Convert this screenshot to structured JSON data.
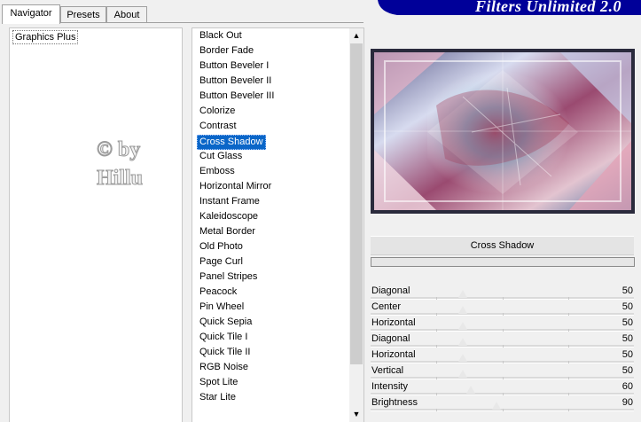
{
  "tabs": [
    {
      "label": "Navigator",
      "active": true
    },
    {
      "label": "Presets",
      "active": false
    },
    {
      "label": "About",
      "active": false
    }
  ],
  "banner": {
    "title": "Filters Unlimited 2.0"
  },
  "category": {
    "selected": "Graphics Plus"
  },
  "watermark": {
    "text": "© by Hillu"
  },
  "filters": {
    "items": [
      "Black Out",
      "Border Fade",
      "Button Beveler I",
      "Button Beveler II",
      "Button Beveler III",
      "Colorize",
      "Contrast",
      "Cross Shadow",
      "Cut Glass",
      "Emboss",
      "Horizontal Mirror",
      "Instant Frame",
      "Kaleidoscope",
      "Metal Border",
      "Old Photo",
      "Page Curl",
      "Panel Stripes",
      "Peacock",
      "Pin Wheel",
      "Quick Sepia",
      "Quick Tile I",
      "Quick Tile II",
      "RGB Noise",
      "Spot Lite",
      "Star Lite"
    ],
    "selected_index": 7
  },
  "scrollbar": {
    "up_icon": "▲",
    "down_icon": "▼"
  },
  "current_filter": {
    "name": "Cross Shadow"
  },
  "parameters": [
    {
      "label": "Diagonal",
      "value": 50
    },
    {
      "label": "Center",
      "value": 50
    },
    {
      "label": "Horizontal",
      "value": 50
    },
    {
      "label": "Diagonal",
      "value": 50
    },
    {
      "label": "Horizontal",
      "value": 50
    },
    {
      "label": "Vertical",
      "value": 50
    },
    {
      "label": "Intensity",
      "value": 60
    },
    {
      "label": "Brightness",
      "value": 90
    }
  ],
  "colors": {
    "selection": "#0a66c8",
    "banner": "#000099"
  }
}
